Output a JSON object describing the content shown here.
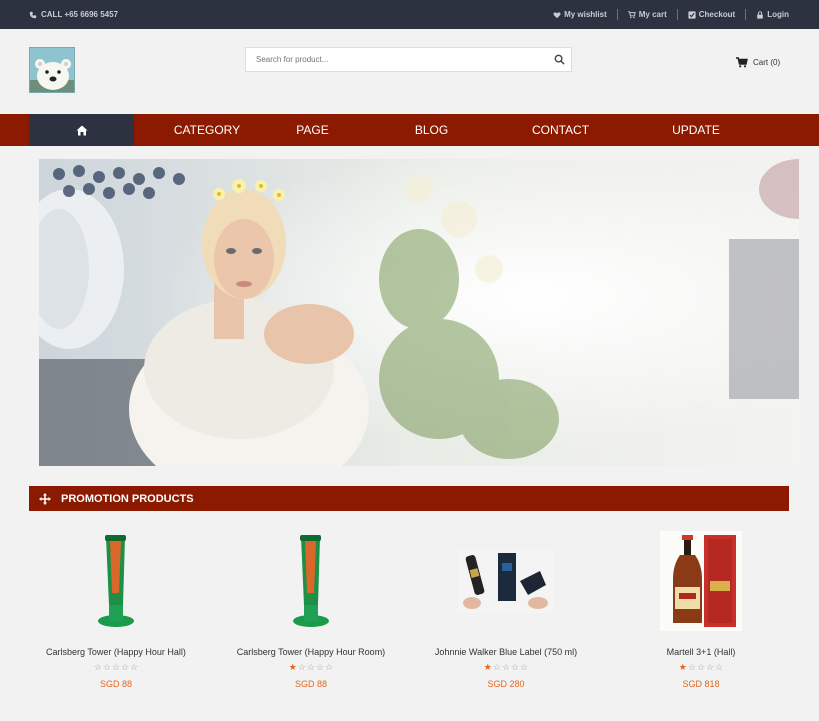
{
  "topbar": {
    "phone": "CALL +65 6696 5457",
    "links": [
      "My wishlist",
      "My cart",
      "Checkout",
      "Login"
    ]
  },
  "header": {
    "search_placeholder": "Search for product...",
    "cart_label": "Cart (0)"
  },
  "nav": {
    "home_icon": "home-icon",
    "items": [
      "CATEGORY",
      "PAGE",
      "BLOG",
      "CONTACT",
      "UPDATE"
    ]
  },
  "promo": {
    "title": "PROMOTION PRODUCTS"
  },
  "products": [
    {
      "name": "Carlsberg Tower (Happy Hour Hall)",
      "rating": 0,
      "price": "SGD 88"
    },
    {
      "name": "Carlsberg Tower (Happy Hour Room)",
      "rating": 1,
      "price": "SGD 88"
    },
    {
      "name": "Johnnie Walker Blue Label (750 ml)",
      "rating": 1,
      "price": "SGD 280"
    },
    {
      "name": "Martell 3+1 (Hall)",
      "rating": 1,
      "price": "SGD 818"
    }
  ],
  "colors": {
    "topbar": "#2d3240",
    "accent": "#8c1a00",
    "price": "#e4661e"
  }
}
